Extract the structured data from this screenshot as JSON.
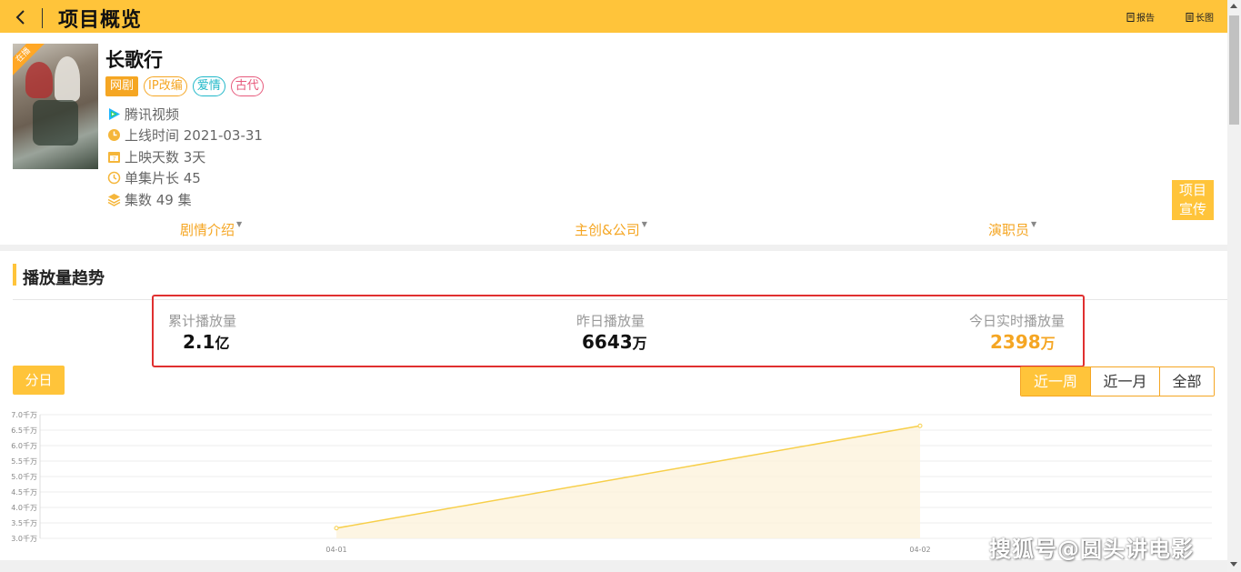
{
  "header": {
    "title": "项目概览",
    "actions": [
      {
        "icon": "report-icon",
        "label": "报告"
      },
      {
        "icon": "long-image-icon",
        "label": "长图"
      }
    ]
  },
  "show": {
    "title": "长歌行",
    "poster_badge": "在播",
    "tags": [
      "网剧",
      "IP改编",
      "爱情",
      "古代"
    ],
    "platform": "腾讯视频",
    "release": "上线时间 2021-03-31",
    "days_online": "上映天数 3天",
    "episode_length": "单集片长 45",
    "episodes": "集数 49 集",
    "promo_button": "项目宣传",
    "promo_line1": "项目",
    "promo_line2": "宣传"
  },
  "tabs": [
    "剧情介绍",
    "主创&公司",
    "演职员"
  ],
  "trend": {
    "section_title": "播放量趋势",
    "stats": [
      {
        "label": "累计播放量",
        "value": "2.1",
        "unit": "亿"
      },
      {
        "label": "昨日播放量",
        "value": "6643",
        "unit": "万"
      },
      {
        "label": "今日实时播放量",
        "value": "2398",
        "unit": "万"
      }
    ],
    "granularity_button": "分日",
    "ranges": [
      "近一周",
      "近一月",
      "全部"
    ],
    "active_range": "近一周"
  },
  "colors": {
    "accent": "#ffc43a",
    "accent_text": "#f5a623",
    "highlight_border": "#e03030"
  },
  "chart_data": {
    "type": "area",
    "x": [
      "04-01",
      "04-02"
    ],
    "series": [
      {
        "values": [
          3.33,
          6.64
        ]
      }
    ],
    "yticks": [
      "3.0千万",
      "3.5千万",
      "4.0千万",
      "4.5千万",
      "5.0千万",
      "5.5千万",
      "6.0千万",
      "6.5千万",
      "7.0千万"
    ],
    "ylim": [
      3.0,
      7.0
    ],
    "yunit": "千万",
    "grid": true
  },
  "watermark": "搜狐号@圆头讲电影"
}
